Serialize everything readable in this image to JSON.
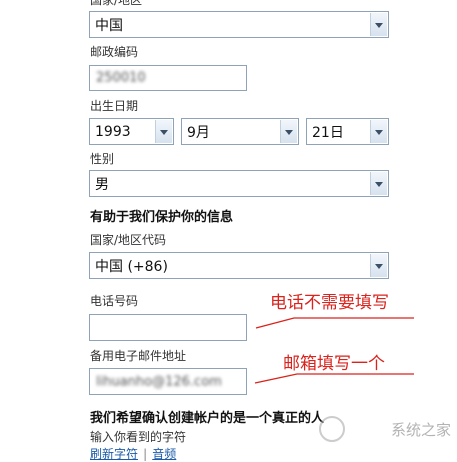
{
  "form": {
    "country_region_label": "国家/地区",
    "country_region_value": "中国",
    "postal_code_label": "邮政编码",
    "postal_code_value": "250010",
    "birth_date_label": "出生日期",
    "birth_year": "1993",
    "birth_month": "9月",
    "birth_day": "21日",
    "gender_label": "性别",
    "gender_value": "男",
    "security_section_title": "有助于我们保护你的信息",
    "country_code_label": "国家/地区代码",
    "country_code_value": "中国 (+86)",
    "phone_label": "电话号码",
    "phone_value": "",
    "alt_email_label": "备用电子邮件地址",
    "alt_email_value": "lihuanho@126.com",
    "captcha_section_title": "我们希望确认创建帐户的是一个真正的人",
    "captcha_prompt": "输入你看到的字符",
    "captcha_refresh": "刷新字符",
    "captcha_separator": "|",
    "captcha_audio": "音频"
  },
  "annotations": {
    "phone_note": "电话不需要填写",
    "email_note": "邮箱填写一个"
  },
  "watermark": {
    "text": "系统之家"
  },
  "colors": {
    "annotation_red": "#d9231c",
    "border": "#8fa3b8",
    "link": "#1a5aa8"
  }
}
